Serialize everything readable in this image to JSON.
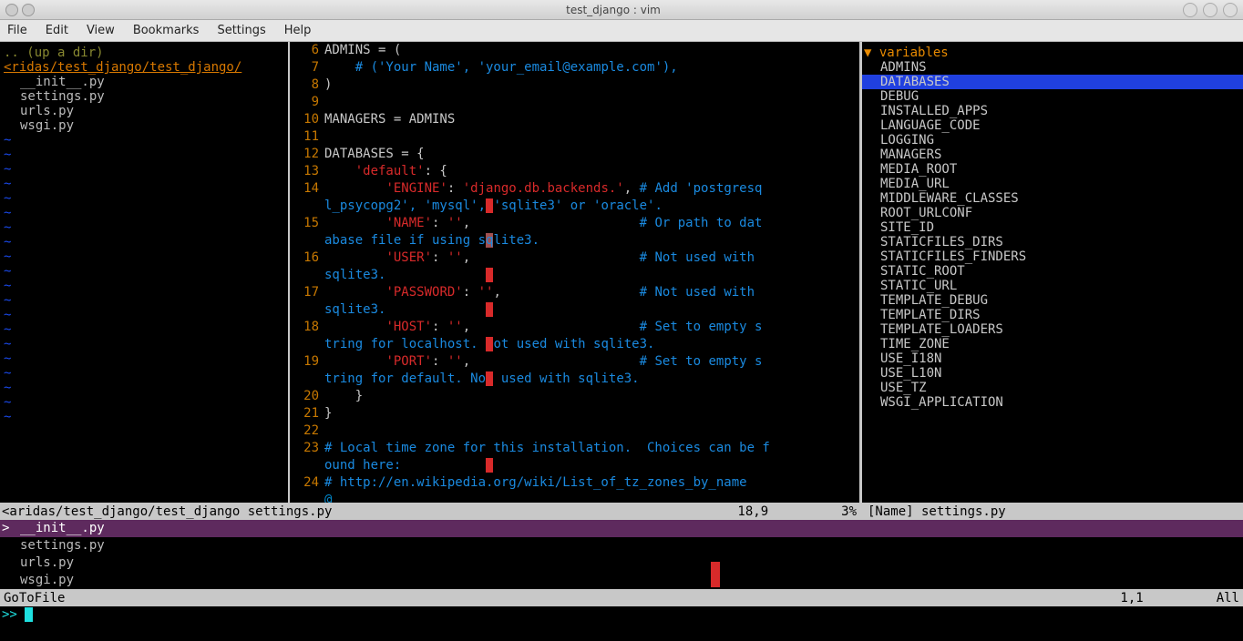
{
  "window": {
    "title": "test_django : vim"
  },
  "menubar": [
    "File",
    "Edit",
    "View",
    "Bookmarks",
    "Settings",
    "Help"
  ],
  "sidebar": {
    "updir": ".. (up a dir)",
    "path": "<ridas/test_django/test_django/",
    "files": [
      "__init__.py",
      "settings.py",
      "urls.py",
      "wsgi.py"
    ]
  },
  "editor": {
    "lines": [
      {
        "n": 6,
        "html": "ADMINS = ("
      },
      {
        "n": 7,
        "html": "    <span class='cm'># ('Your Name', 'your_email@example.com'),</span>"
      },
      {
        "n": 8,
        "html": ")"
      },
      {
        "n": 9,
        "html": ""
      },
      {
        "n": 10,
        "html": "MANAGERS = ADMINS"
      },
      {
        "n": 11,
        "html": ""
      },
      {
        "n": 12,
        "html": "DATABASES = {"
      },
      {
        "n": 13,
        "html": "    <span class='str'>'default'</span>: {"
      },
      {
        "n": 14,
        "html": "        <span class='str'>'ENGINE'</span>: <span class='str'>'django.db.backends.'</span>, <span class='cm'># Add 'postgresq</span>"
      },
      {
        "n": "",
        "html": "<span class='cm'>l_psycopg2', 'mysql',<span class='hl'> </span>'sqlite3' or 'oracle'.</span>"
      },
      {
        "n": 15,
        "html": "        <span class='str'>'NAME'</span>: <span class='str'>''</span>,                      <span class='cm'># Or path to dat</span>"
      },
      {
        "n": "",
        "html": "<span class='cm'>abase file if using s<span class='hlcur'>q</span>lite3.</span>"
      },
      {
        "n": 16,
        "html": "        <span class='str'>'USER'</span>: <span class='str'>''</span>,                      <span class='cm'># Not used with </span>"
      },
      {
        "n": "",
        "html": "<span class='cm'>sqlite3.             <span class='hl'> </span></span>"
      },
      {
        "n": 17,
        "html": "        <span class='str'>'PASSWORD'</span>: <span class='str'>''</span>,                  <span class='cm'># Not used with </span>"
      },
      {
        "n": "",
        "html": "<span class='cm'>sqlite3.             <span class='hl'> </span></span>"
      },
      {
        "n": 18,
        "html": "        <span class='str'>'HOST'</span>: <span class='str'>''</span>,                      <span class='cm'># Set to empty s</span>"
      },
      {
        "n": "",
        "html": "<span class='cm'>tring for localhost. <span class='hl'>N</span>ot used with sqlite3.</span>"
      },
      {
        "n": 19,
        "html": "        <span class='str'>'PORT'</span>: <span class='str'>''</span>,                      <span class='cm'># Set to empty s</span>"
      },
      {
        "n": "",
        "html": "<span class='cm'>tring for default. No<span class='hl'>t</span> used with sqlite3.</span>"
      },
      {
        "n": 20,
        "html": "    }"
      },
      {
        "n": 21,
        "html": "}"
      },
      {
        "n": 22,
        "html": ""
      },
      {
        "n": 23,
        "html": "<span class='cm'># Local time zone for this installation.  Choices can be f</span>"
      },
      {
        "n": "",
        "html": "<span class='cm'>ound here:           <span class='hl'> </span></span>"
      },
      {
        "n": 24,
        "html": "<span class='cm'># http://en.wikipedia.org/wiki/List_of_tz_zones_by_name</span>"
      }
    ],
    "at": "@"
  },
  "outline": {
    "header": "variables",
    "items": [
      "ADMINS",
      "DATABASES",
      "DEBUG",
      "INSTALLED_APPS",
      "LANGUAGE_CODE",
      "LOGGING",
      "MANAGERS",
      "MEDIA_ROOT",
      "MEDIA_URL",
      "MIDDLEWARE_CLASSES",
      "ROOT_URLCONF",
      "SITE_ID",
      "STATICFILES_DIRS",
      "STATICFILES_FINDERS",
      "STATIC_ROOT",
      "STATIC_URL",
      "TEMPLATE_DEBUG",
      "TEMPLATE_DIRS",
      "TEMPLATE_LOADERS",
      "TIME_ZONE",
      "USE_I18N",
      "USE_L10N",
      "USE_TZ",
      "WSGI_APPLICATION"
    ],
    "selected": "DATABASES"
  },
  "status1": {
    "path": "<aridas/test_django/test_django ",
    "file": "settings.py",
    "pos": "18,9",
    "pct": "3%",
    "right": "[Name] settings.py"
  },
  "gotofile": {
    "items": [
      "__init__.py",
      "settings.py",
      "urls.py",
      "wsgi.py"
    ],
    "selected": "__init__.py"
  },
  "status2": {
    "label": "GoToFile",
    "pos": "1,1",
    "pct": "All"
  },
  "cmdline": {
    "prompt": ">> "
  }
}
